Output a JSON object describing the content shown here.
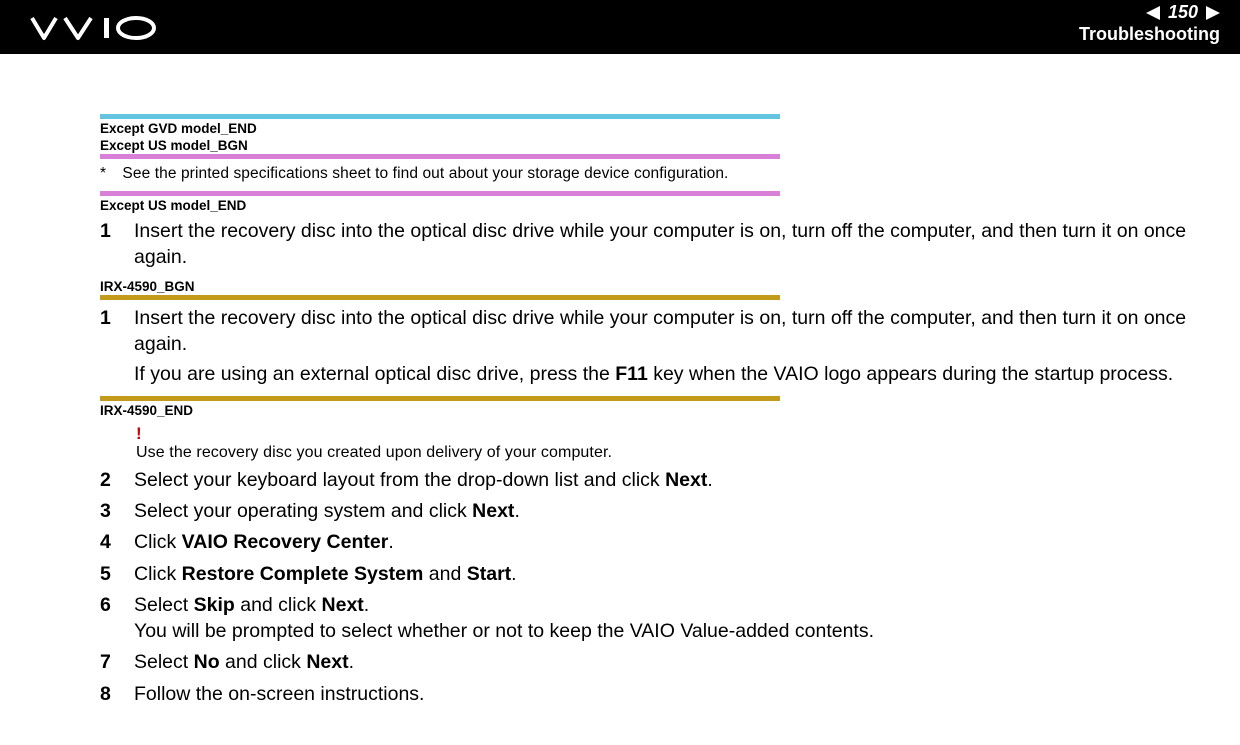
{
  "header": {
    "page_number": "150",
    "section": "Troubleshooting",
    "logo_alt": "VAIO"
  },
  "markers": {
    "except_gvd_model_end": "Except GVD model_END",
    "except_us_model_bgn": "Except US model_BGN",
    "except_us_model_end": "Except US model_END",
    "irx_4590_bgn": "IRX-4590_BGN",
    "irx_4590_end": "IRX-4590_END"
  },
  "footnote": {
    "symbol": "*",
    "text": "See the printed specifications sheet to find out about your storage device configuration."
  },
  "steps_a": {
    "1": {
      "num": "1",
      "text": "Insert the recovery disc into the optical disc drive while your computer is on, turn off the computer, and then turn it on once again."
    }
  },
  "steps_b": {
    "1": {
      "num": "1",
      "text": "Insert the recovery disc into the optical disc drive while your computer is on, turn off the computer, and then turn it on once again.",
      "sub_pre": "If you are using an external optical disc drive, press the ",
      "sub_bold": "F11",
      "sub_post": " key when the VAIO logo appears during the startup process."
    }
  },
  "alert": {
    "mark": "!",
    "text": "Use the recovery disc you created upon delivery of your computer."
  },
  "steps_c": {
    "2": {
      "num": "2",
      "pre": "Select your keyboard layout from the drop-down list and click ",
      "b1": "Next",
      "post": "."
    },
    "3": {
      "num": "3",
      "pre": "Select your operating system and click ",
      "b1": "Next",
      "post": "."
    },
    "4": {
      "num": "4",
      "pre": "Click ",
      "b1": "VAIO Recovery Center",
      "post": "."
    },
    "5": {
      "num": "5",
      "pre": "Click ",
      "b1": "Restore Complete System",
      "mid": " and ",
      "b2": "Start",
      "post": "."
    },
    "6": {
      "num": "6",
      "pre": "Select ",
      "b1": "Skip",
      "mid": " and click ",
      "b2": "Next",
      "post": ".",
      "line2": "You will be prompted to select whether or not to keep the VAIO Value-added contents."
    },
    "7": {
      "num": "7",
      "pre": "Select ",
      "b1": "No",
      "mid": " and click ",
      "b2": "Next",
      "post": "."
    },
    "8": {
      "num": "8",
      "pre": "Follow the on-screen instructions."
    }
  }
}
